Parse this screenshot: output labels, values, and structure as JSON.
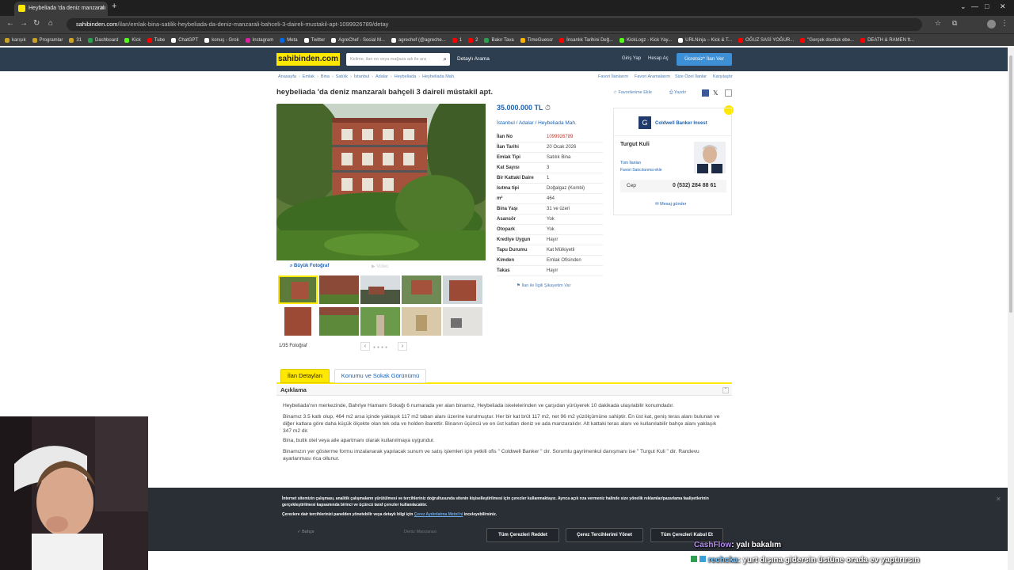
{
  "browser": {
    "tab_title": "Heybeliada 'da deniz manzaralı",
    "url_host": "sahibinden.com",
    "url_path": "/ilan/emlak-bina-satilik-heybeliada-da-deniz-manzarali-bahceli-3-daireli-mustakil-apt-1099926789/detay",
    "bookmarks": [
      {
        "label": "karışık",
        "color": "#c9a227"
      },
      {
        "label": "Programlar",
        "color": "#c9a227"
      },
      {
        "label": "31",
        "color": "#c9a227"
      },
      {
        "label": "Dashboard",
        "color": "#2e9e4f"
      },
      {
        "label": "Kick",
        "color": "#53fc18"
      },
      {
        "label": "Tube",
        "color": "#ff0000"
      },
      {
        "label": "ChatGPT",
        "color": "#ffffff"
      },
      {
        "label": "konuş - Grok",
        "color": "#ffffff"
      },
      {
        "label": "Instagram",
        "color": "#d6249f"
      },
      {
        "label": "Meta",
        "color": "#0668e1"
      },
      {
        "label": "Twitter",
        "color": "#ffffff"
      },
      {
        "label": "AgreChef - Social M...",
        "color": "#ffffff"
      },
      {
        "label": "agrechef (@agreche...",
        "color": "#ffffff"
      },
      {
        "label": "1",
        "color": "#ff0000"
      },
      {
        "label": "2",
        "color": "#ff0000"
      },
      {
        "label": "Bakır Tava",
        "color": "#2e9e4f"
      },
      {
        "label": "TimeGuessr",
        "color": "#ffb300"
      },
      {
        "label": "İnsanlık Tarihini Değ...",
        "color": "#ff0000"
      },
      {
        "label": "KickLogz - Kick Yay...",
        "color": "#53fc18"
      },
      {
        "label": "URLNinja – Kick & T...",
        "color": "#ffffff"
      },
      {
        "label": "OĞUZ SASİ YOĞUR...",
        "color": "#ff0000"
      },
      {
        "label": "\"Gerçek dostluk ebe...",
        "color": "#ff0000"
      },
      {
        "label": "DEATH & RAMEN ft...",
        "color": "#ff0000"
      }
    ]
  },
  "header": {
    "logo": "sahibinden.com",
    "search_placeholder": "Kelime, ilan no veya mağaza adı ile ara",
    "detailed_search": "Detaylı Arama",
    "login": "Giriş Yap",
    "register": "Hesap Aç",
    "post_ad": "Ücretsiz* İlan Ver"
  },
  "breadcrumb": [
    "Anasayfa",
    "Emlak",
    "Bina",
    "Satılık",
    "İstanbul",
    "Adalar",
    "Heybeliada",
    "Heybeliada Mah."
  ],
  "breadcrumb_right": [
    "Favori İlanlarım",
    "Favori Aramalarım",
    "Size Özel İlanlar",
    "Karşılaştır"
  ],
  "listing": {
    "title": "heybeliada 'da deniz manzaralı bahçeli 3 daireli müstakil apt.",
    "fav_add": "Favorilerime Ekle",
    "print": "Yazdır",
    "price": "35.000.000 TL",
    "location": [
      "İstanbul",
      "Adalar",
      "Heybeliada Mah."
    ],
    "details": [
      {
        "k": "İlan No",
        "v": "1099926789",
        "red": true
      },
      {
        "k": "İlan Tarihi",
        "v": "20 Ocak 2026"
      },
      {
        "k": "Emlak Tipi",
        "v": "Satılık Bina"
      },
      {
        "k": "Kat Sayısı",
        "v": "3"
      },
      {
        "k": "Bir Kattaki Daire",
        "v": "1"
      },
      {
        "k": "Isıtma tipi",
        "v": "Doğalgaz (Kombi)"
      },
      {
        "k": "m²",
        "v": "464"
      },
      {
        "k": "Bina Yaşı",
        "v": "31 ve üzeri"
      },
      {
        "k": "Asansör",
        "v": "Yok"
      },
      {
        "k": "Otopark",
        "v": "Yok"
      },
      {
        "k": "Krediye Uygun",
        "v": "Hayır"
      },
      {
        "k": "Tapu Durumu",
        "v": "Kat Mülkiyetli"
      },
      {
        "k": "Kimden",
        "v": "Emlak Ofisinden"
      },
      {
        "k": "Takas",
        "v": "Hayır"
      }
    ],
    "complaint": "İlan ile İlgili Şikayetim Var"
  },
  "gallery": {
    "big_photo": "Büyük Fotoğraf",
    "video": "Video",
    "counter": "1/35 Fotoğraf"
  },
  "agent": {
    "office": "Coldwell Banker Invest",
    "name": "Turgut Kuli",
    "all_ads": "Tüm İlanları",
    "fav_seller": "Favori Satıcılarıma ekle",
    "phone_label": "Cep",
    "phone": "0 (532) 284 88 61",
    "message": "Mesaj gönder"
  },
  "tabs": {
    "details": "İlan Detayları",
    "location": "Konumu ve Sokak Görünümü"
  },
  "description": {
    "heading": "Açıklama",
    "paragraphs": [
      "Heybeliada'nın merkezinde, Bahriye Hamamı Sokağı 6 numarada yer alan binamız, Heybeliada iskelelerinden ve çarşıdan yürüyerek 10 dakikada ulaşılabilir konumdadır.",
      "Binamız 3.5 katlı olup, 464 m2 arsa içinde yaklaşık 117 m2 taban alanı üzerine kurulmuştur. Her bir kat brüt 117 m2, net 96 m2 yüzölçümüne sahiptir. En üst kat, geniş teras alanı bulunan ve diğer katlara göre daha küçük ölçekte olan tek oda ve holden ibarettir. Binanın üçüncü ve en üst katları deniz ve ada manzaralıdır. Alt kattaki teras alanı ve kullanılabilir bahçe alanı yaklaşık 347 m2 dir.",
      "Bina, butik otel veya aile apartmanı olarak kullanılmaya uygundur.",
      "Binamızın yer gösterme formu imzalanarak yapılacak sunum ve satış işlemleri için yetkili ofis \" Coldwell Banker \" dır. Sorumlu gayrimenkul danışmanı ise \" Turgut Kuli \" dir. Randevu ayarlanması rica ollunur."
    ]
  },
  "cookie": {
    "text1": "İnternet sitemizin çalışması, analitik çalışmaların yürütülmesi ve tercihleriniz doğrultusunda sitenin kişiselleştirilmesi için çerezler kullanmaktayız. Ayrıca açık rıza vermeniz halinde size yönelik reklamlar/pazarlama faaliyetlerinin gerçekleştirilmesi kapsamında birinci ve üçüncü taraf çerezler kullanılacaktır.",
    "text2a": "Çerezlere dair tercihlerinizi panelden yönetebilir veya detaylı bilgi için",
    "text2link": "Çerez Aydınlatma Metni'ni",
    "text2b": "inceleyebilirsiniz.",
    "reject": "Tüm Çerezleri Reddet",
    "manage": "Çerez Tercihlerimi Yönet",
    "accept": "Tüm Çerezleri Kabul Et",
    "behind1": "Bahçe",
    "behind2": "Deniz Manzarası"
  },
  "stream": {
    "chat1_user": "CashFlow",
    "chat1_msg": ": yalı bakalım",
    "chat2_user": "rechcka",
    "chat2_msg": ": yurt dışına gidersin üstüne orada ev yaptırırsın",
    "chat1_color": "#b48cf0",
    "chat2_color": "#6fc3ff"
  }
}
